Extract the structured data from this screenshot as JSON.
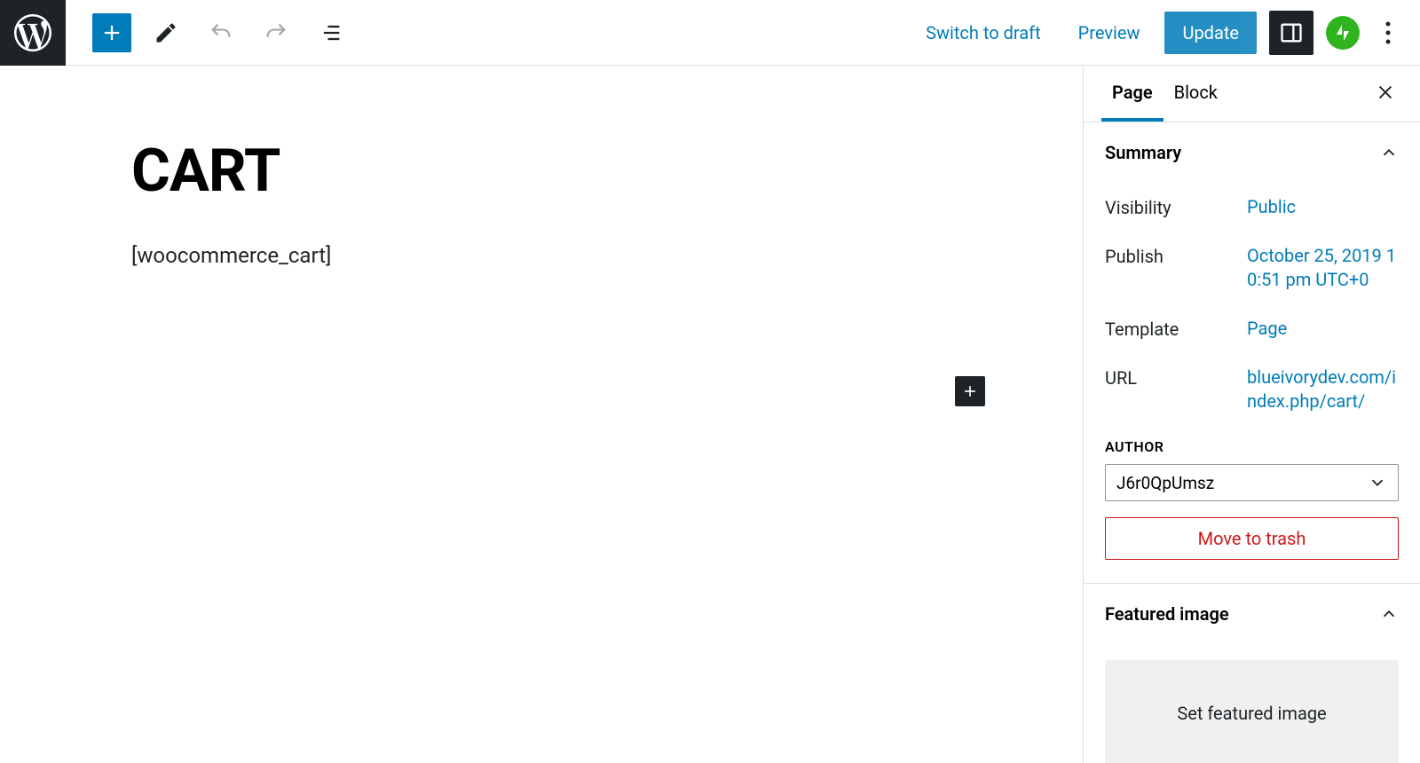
{
  "toolbar": {
    "switch_draft": "Switch to draft",
    "preview": "Preview",
    "update": "Update"
  },
  "editor": {
    "title": "CART",
    "block_text": "[woocommerce_cart]"
  },
  "sidebar": {
    "tabs": {
      "page": "Page",
      "block": "Block"
    },
    "summary": {
      "title": "Summary",
      "visibility_label": "Visibility",
      "visibility_value": "Public",
      "publish_label": "Publish",
      "publish_value": "October 25, 2019 10:51 pm UTC+0",
      "template_label": "Template",
      "template_value": "Page",
      "url_label": "URL",
      "url_value": "blueivorydev.com/index.php/cart/",
      "author_label": "AUTHOR",
      "author_value": "J6r0QpUmsz",
      "trash": "Move to trash"
    },
    "featured": {
      "title": "Featured image",
      "set": "Set featured image"
    }
  }
}
